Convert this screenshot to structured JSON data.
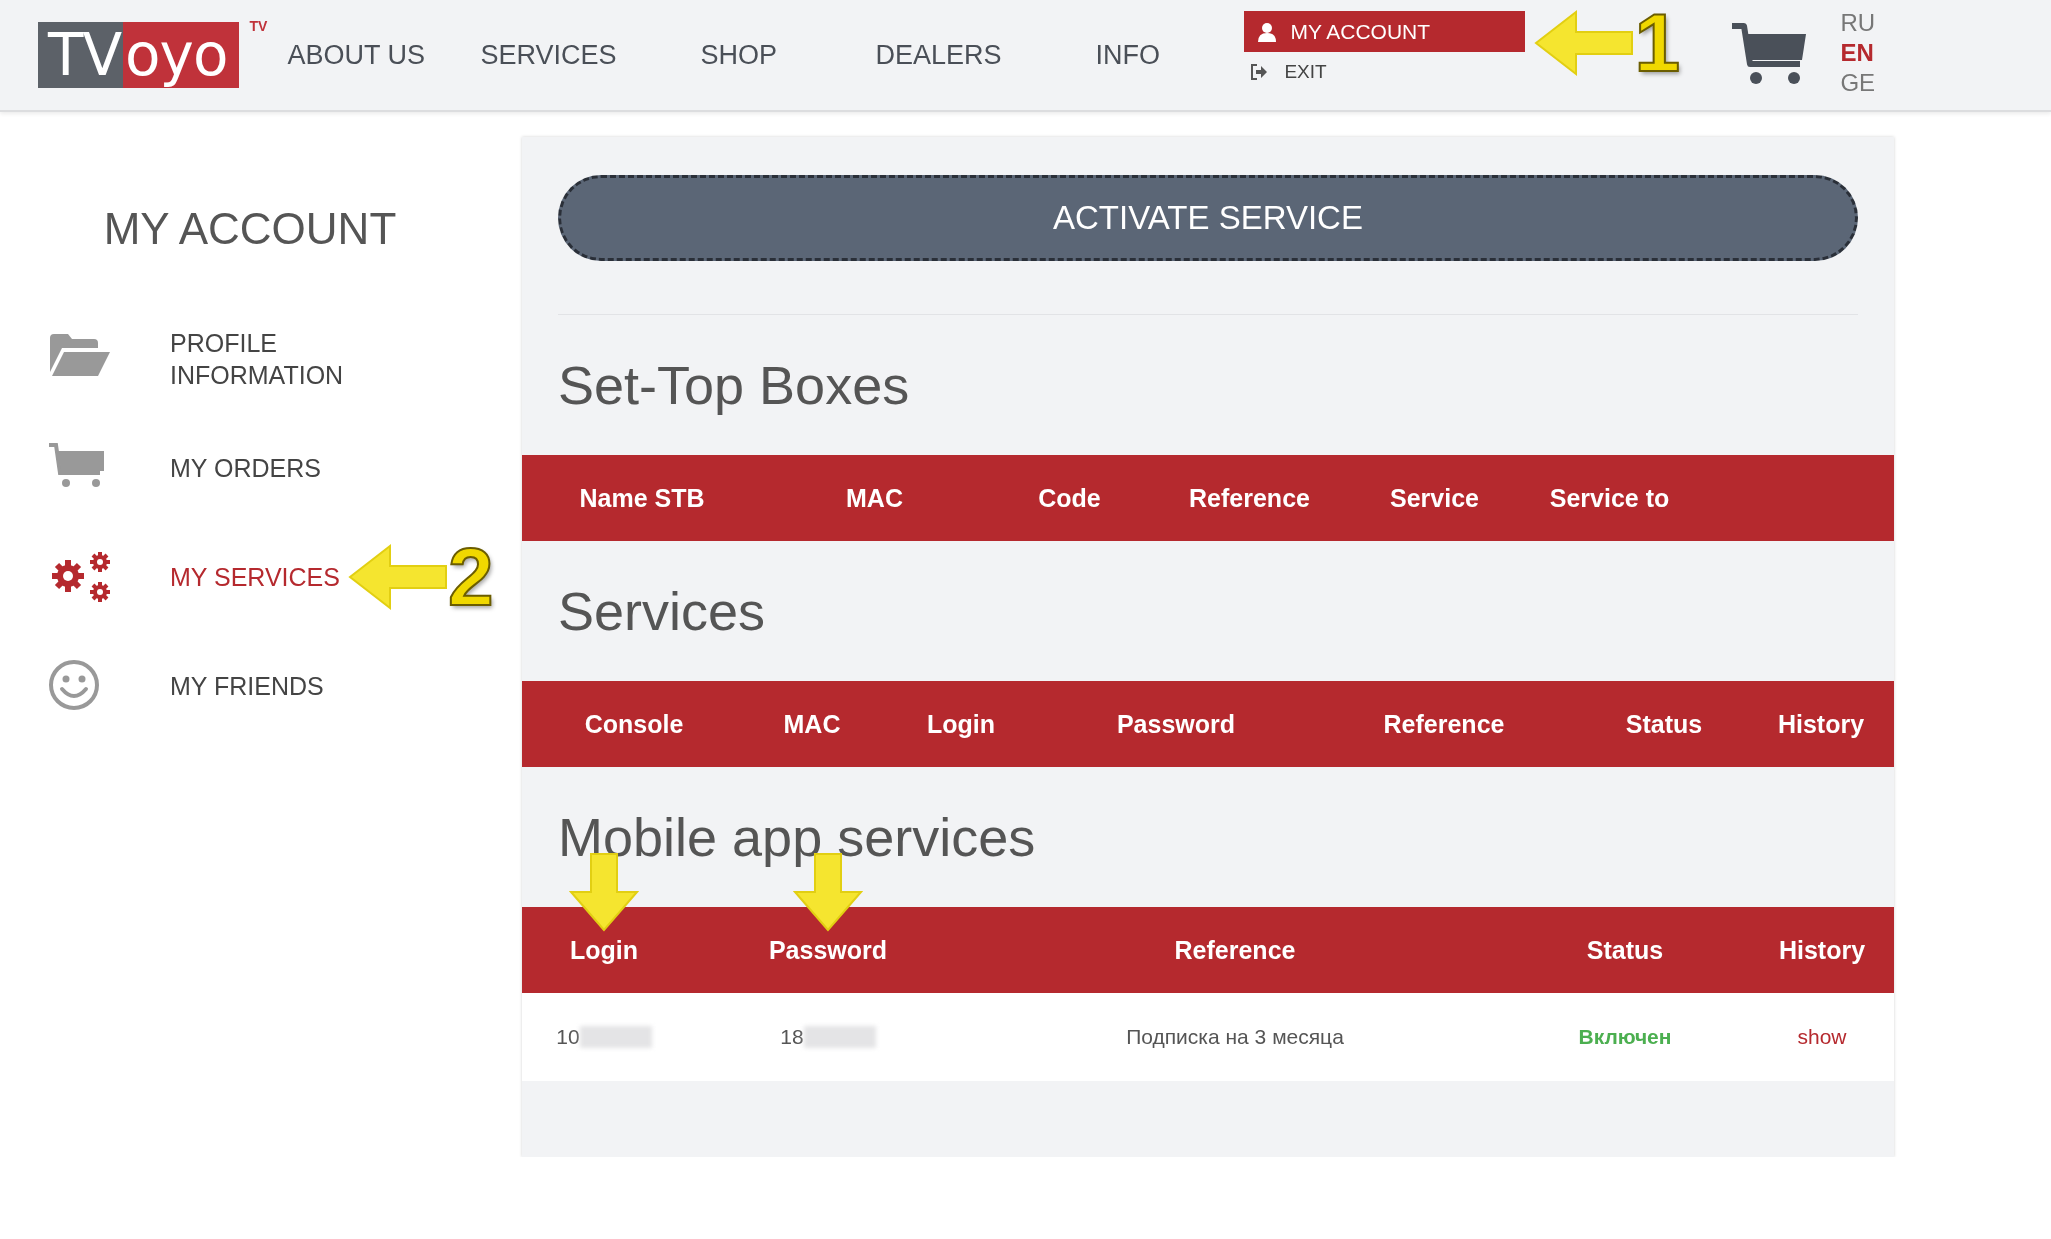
{
  "header": {
    "logo": {
      "parts": [
        "TV",
        "oyo"
      ],
      "badge": "TV"
    },
    "nav": [
      {
        "label": "ABOUT US"
      },
      {
        "label": "SERVICES"
      },
      {
        "label": "SHOP"
      },
      {
        "label": "DEALERS"
      },
      {
        "label": "INFO"
      }
    ],
    "account_menu": {
      "account": "MY ACCOUNT",
      "exit": "EXIT",
      "callout": "1"
    },
    "languages": [
      {
        "label": "RU",
        "selected": false
      },
      {
        "label": "EN",
        "selected": true
      },
      {
        "label": "GE",
        "selected": false
      }
    ]
  },
  "sidebar": {
    "title": "MY ACCOUNT",
    "items": [
      {
        "kind": "folder",
        "label": "PROFILE INFORMATION",
        "selected": false
      },
      {
        "kind": "cart",
        "label": "MY ORDERS",
        "selected": false
      },
      {
        "kind": "gears",
        "label": "MY SERVICES",
        "selected": true,
        "callout": "2"
      },
      {
        "kind": "smiley",
        "label": "MY FRIENDS",
        "selected": false
      }
    ]
  },
  "main": {
    "activate_button": "ACTIVATE SERVICE",
    "tables": [
      {
        "kind": "stb",
        "title": "Set-Top Boxes",
        "columns": [
          {
            "label": "Name STB",
            "marked": false
          },
          {
            "label": "MAC",
            "marked": false
          },
          {
            "label": "Code",
            "marked": false
          },
          {
            "label": "Reference",
            "marked": false
          },
          {
            "label": "Service",
            "marked": false
          },
          {
            "label": "Service to",
            "marked": false
          }
        ]
      },
      {
        "kind": "services",
        "title": "Services",
        "columns": [
          {
            "label": "Console",
            "marked": false
          },
          {
            "label": "MAC",
            "marked": false
          },
          {
            "label": "Login",
            "marked": false
          },
          {
            "label": "Password",
            "marked": false
          },
          {
            "label": "Reference",
            "marked": false
          },
          {
            "label": "Status",
            "marked": false
          },
          {
            "label": "History",
            "marked": false
          }
        ]
      },
      {
        "kind": "mobile",
        "title": "Mobile app services",
        "columns": [
          {
            "label": "Login",
            "marked": true
          },
          {
            "label": "Password",
            "marked": true
          },
          {
            "label": "Reference",
            "marked": false
          },
          {
            "label": "Status",
            "marked": false
          },
          {
            "label": "History",
            "marked": false
          }
        ],
        "rows": [
          [
            {
              "kind": "text",
              "text": "10",
              "redacted": true
            },
            {
              "kind": "text",
              "text": "18",
              "redacted": true
            },
            {
              "kind": "text",
              "text": "Подписка на 3 месяца",
              "redacted": false
            },
            {
              "kind": "status",
              "text": "Включен",
              "redacted": false
            },
            {
              "kind": "link",
              "text": "show",
              "redacted": false
            }
          ]
        ]
      }
    ]
  }
}
